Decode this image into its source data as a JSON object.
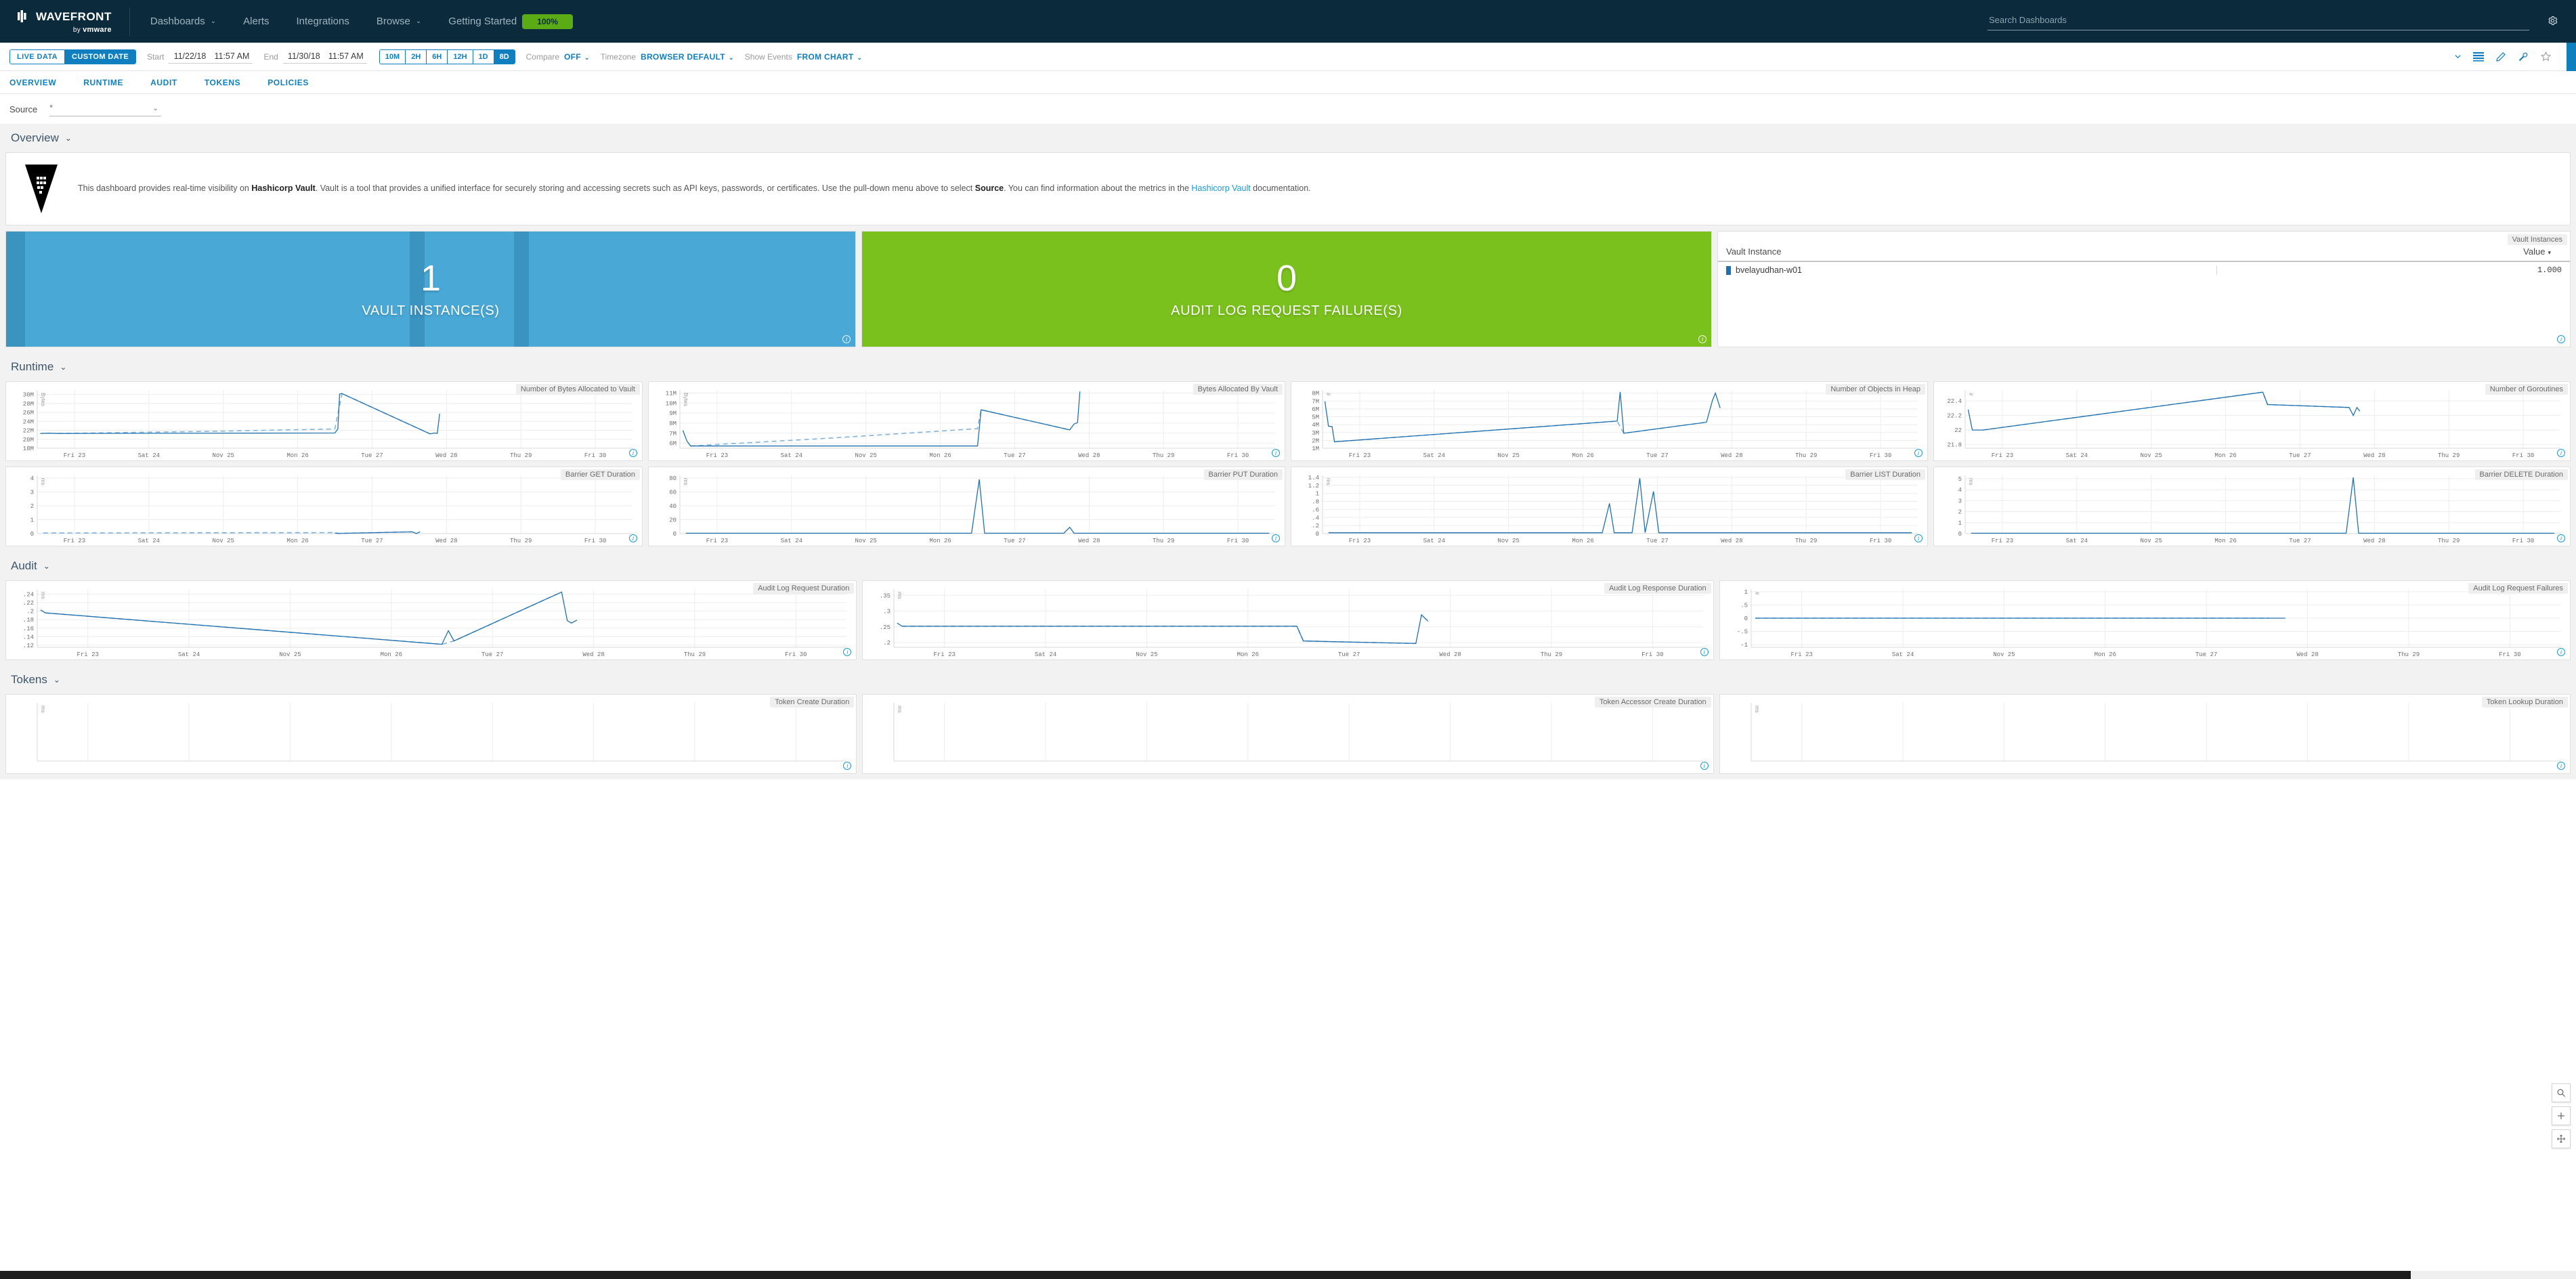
{
  "nav": {
    "brand_name": "WAVEFRONT",
    "brand_sub_prefix": "by ",
    "brand_sub_bold": "vmware",
    "items": [
      {
        "label": "Dashboards",
        "caret": "chevron-down"
      },
      {
        "label": "Alerts",
        "caret": null
      },
      {
        "label": "Integrations",
        "caret": null
      },
      {
        "label": "Browse",
        "caret": "chevron-down"
      },
      {
        "label": "Getting Started",
        "caret": null
      }
    ],
    "progress_pill": "100%",
    "search_placeholder": "Search Dashboards",
    "gear_icon": "gear-icon"
  },
  "toolbar": {
    "live_data": "LIVE DATA",
    "custom_date": "CUSTOM DATE",
    "start_label": "Start",
    "start_date": "11/22/18",
    "start_time": "11:57 AM",
    "end_label": "End",
    "end_date": "11/30/18",
    "end_time": "11:57 AM",
    "ranges": [
      "10M",
      "2H",
      "6H",
      "12H",
      "1D",
      "8D"
    ],
    "active_range": "8D",
    "compare_label": "Compare",
    "compare_value": "OFF",
    "timezone_label": "Timezone",
    "timezone_value": "BROWSER DEFAULT",
    "events_label": "Show Events",
    "events_value": "FROM CHART",
    "icons": [
      "chevron-down-icon",
      "list-icon",
      "pencil-icon",
      "wrench-icon",
      "star-icon"
    ]
  },
  "tabs": {
    "items": [
      "OVERVIEW",
      "RUNTIME",
      "AUDIT",
      "TOKENS",
      "POLICIES"
    ],
    "active": "OVERVIEW"
  },
  "source": {
    "label": "Source",
    "value": "*",
    "caret": "chevron-down-icon"
  },
  "sections": {
    "overview": {
      "title": "Overview",
      "description_parts": [
        "This dashboard provides real-time visibility on ",
        "Hashicorp Vault",
        ". Vault is a tool that provides a unified interface for securely storing and accessing secrets such as API keys, passwords, or certificates. Use the pull-down menu above to select ",
        "Source",
        ". You can find information about the metrics in the ",
        "Hashicorp Vault",
        " documentation."
      ],
      "tiles": [
        {
          "value": "1",
          "caption": "VAULT INSTANCE(S)",
          "color": "#49a8d6"
        },
        {
          "value": "0",
          "caption": "AUDIT LOG REQUEST FAILURE(S)",
          "color": "#7ac11e"
        }
      ],
      "table": {
        "chip": "Vault Instances",
        "columns": [
          "Vault Instance",
          "Value"
        ],
        "sort_caret": "▾",
        "rows": [
          {
            "name": "bvelayudhan-w01",
            "value": "1.000",
            "swatch": "#1f6fb2"
          }
        ]
      }
    },
    "runtime": {
      "title": "Runtime"
    },
    "audit": {
      "title": "Audit"
    },
    "tokens": {
      "title": "Tokens"
    }
  },
  "float_buttons": [
    {
      "icon": "search-icon",
      "glyph": "⚲"
    },
    {
      "icon": "plus-icon",
      "glyph": "+"
    },
    {
      "icon": "move-icon",
      "glyph": "✥"
    }
  ],
  "chart_data": [
    {
      "id": "bytes-allocated-to-vault",
      "type": "line",
      "title": "Number of Bytes Allocated to Vault",
      "ylabel": "Bytes",
      "yticks": [
        "30M",
        "28M",
        "26M",
        "24M",
        "22M",
        "20M",
        "18M"
      ],
      "ylim": [
        18000000,
        31000000
      ],
      "xticks": [
        "Fri 23",
        "Sat 24",
        "Nov 25",
        "Mon 26",
        "Tue 27",
        "Wed 28",
        "Thu 29",
        "Fri 30"
      ],
      "grid": true,
      "solid": [
        [
          0.005,
          21.3
        ],
        [
          0.02,
          21.35
        ],
        [
          0.035,
          21.3
        ],
        [
          0.5,
          21.4
        ],
        [
          0.505,
          22.3
        ],
        [
          0.508,
          30.1
        ],
        [
          0.512,
          30.2
        ],
        [
          0.66,
          21.2
        ],
        [
          0.668,
          21.4
        ],
        [
          0.672,
          21.3
        ],
        [
          0.676,
          25.7
        ]
      ],
      "dash": [
        [
          0.035,
          21.3
        ],
        [
          0.3,
          21.8
        ],
        [
          0.5,
          22.3
        ],
        [
          0.512,
          30.2
        ],
        [
          0.66,
          21.2
        ]
      ],
      "units": "M"
    },
    {
      "id": "bytes-allocated-by-vault",
      "type": "line",
      "title": "Bytes Allocated By Vault",
      "ylabel": "Bytes",
      "yticks": [
        "11M",
        "10M",
        "9M",
        "8M",
        "7M",
        "6M"
      ],
      "ylim": [
        5500000,
        11300000
      ],
      "xticks": [
        "Fri 23",
        "Sat 24",
        "Nov 25",
        "Mon 26",
        "Tue 27",
        "Wed 28",
        "Thu 29",
        "Fri 30"
      ],
      "grid": true,
      "solid": [
        [
          0.005,
          7.28
        ],
        [
          0.012,
          6.2
        ],
        [
          0.018,
          5.72
        ],
        [
          0.5,
          5.72
        ],
        [
          0.503,
          7.45
        ],
        [
          0.506,
          9.33
        ],
        [
          0.655,
          7.33
        ],
        [
          0.662,
          7.9
        ],
        [
          0.668,
          8.05
        ],
        [
          0.672,
          11.15
        ]
      ],
      "dash": [
        [
          0.018,
          5.72
        ],
        [
          0.25,
          6.5
        ],
        [
          0.5,
          7.45
        ],
        [
          0.506,
          9.33
        ],
        [
          0.655,
          7.33
        ]
      ],
      "units": "M"
    },
    {
      "id": "objects-in-heap",
      "type": "line",
      "title": "Number of Objects in Heap",
      "ylabel": "#",
      "yticks": [
        "8M",
        "7M",
        "6M",
        "5M",
        "4M",
        "3M",
        "2M",
        "1M"
      ],
      "ylim": [
        1000000,
        8400000
      ],
      "xticks": [
        "Fri 23",
        "Sat 24",
        "Nov 25",
        "Mon 26",
        "Tue 27",
        "Wed 28",
        "Thu 29",
        "Fri 30"
      ],
      "grid": true,
      "solid": [
        [
          0.004,
          6.95
        ],
        [
          0.01,
          3.8
        ],
        [
          0.016,
          3.75
        ],
        [
          0.02,
          1.82
        ],
        [
          0.495,
          4.45
        ],
        [
          0.5,
          8.15
        ],
        [
          0.506,
          2.9
        ],
        [
          0.645,
          4.3
        ],
        [
          0.655,
          7.05
        ],
        [
          0.66,
          8.0
        ],
        [
          0.668,
          6.1
        ]
      ],
      "dash": [
        [
          0.02,
          1.82
        ],
        [
          0.25,
          3.1
        ],
        [
          0.495,
          4.45
        ],
        [
          0.506,
          2.9
        ],
        [
          0.645,
          4.3
        ]
      ],
      "units": "M"
    },
    {
      "id": "goroutines",
      "type": "line",
      "title": "Number of Goroutines",
      "ylabel": "#",
      "yticks": [
        "22.4",
        "22.2",
        "22",
        "21.8"
      ],
      "ylim": [
        21.75,
        22.55
      ],
      "xticks": [
        "Fri 23",
        "Sat 24",
        "Nov 25",
        "Mon 26",
        "Tue 27",
        "Wed 28",
        "Thu 29",
        "Fri 30"
      ],
      "grid": true,
      "solid": [
        [
          0.005,
          22.28
        ],
        [
          0.012,
          22.0
        ],
        [
          0.03,
          22.0
        ],
        [
          0.5,
          22.52
        ],
        [
          0.508,
          22.35
        ],
        [
          0.645,
          22.31
        ],
        [
          0.652,
          22.2
        ],
        [
          0.658,
          22.31
        ],
        [
          0.663,
          22.26
        ]
      ],
      "dash": [
        [
          0.03,
          22.0
        ],
        [
          0.5,
          22.52
        ],
        [
          0.508,
          22.35
        ],
        [
          0.645,
          22.31
        ]
      ],
      "units": ""
    },
    {
      "id": "barrier-get-duration",
      "type": "line",
      "title": "Barrier GET Duration",
      "ylabel": "ms",
      "yticks": [
        "4",
        "3",
        "2",
        "1",
        "0"
      ],
      "ylim": [
        0,
        4.2
      ],
      "xticks": [
        "Fri 23",
        "Sat 24",
        "Nov 25",
        "Mon 26",
        "Tue 27",
        "Wed 28",
        "Thu 29",
        "Fri 30"
      ],
      "grid": true,
      "solid": [
        [
          0.5,
          0.03
        ],
        [
          0.505,
          0.01
        ],
        [
          0.63,
          0.12
        ],
        [
          0.637,
          0.0
        ],
        [
          0.643,
          0.12
        ]
      ],
      "dash": [
        [
          0.01,
          0.04
        ],
        [
          0.3,
          0.06
        ],
        [
          0.5,
          0.07
        ],
        [
          0.505,
          0.01
        ],
        [
          0.63,
          0.12
        ]
      ],
      "units": "ms"
    },
    {
      "id": "barrier-put-duration",
      "type": "line",
      "title": "Barrier PUT Duration",
      "ylabel": "ms",
      "yticks": [
        "80",
        "60",
        "40",
        "20",
        "0"
      ],
      "ylim": [
        0,
        84
      ],
      "xticks": [
        "Fri 23",
        "Sat 24",
        "Nov 25",
        "Mon 26",
        "Tue 27",
        "Wed 28",
        "Thu 29",
        "Fri 30"
      ],
      "grid": true,
      "solid": [
        [
          0.01,
          0.5
        ],
        [
          0.49,
          0.5
        ],
        [
          0.503,
          78
        ],
        [
          0.512,
          0.5
        ],
        [
          0.645,
          0.5
        ],
        [
          0.655,
          9
        ],
        [
          0.662,
          0.5
        ],
        [
          0.99,
          0.5
        ]
      ],
      "dash": [],
      "units": "ms"
    },
    {
      "id": "barrier-list-duration",
      "type": "line",
      "title": "Barrier LIST Duration",
      "ylabel": "ms",
      "yticks": [
        "1.4",
        "1.2",
        "1",
        ".8",
        ".6",
        ".4",
        ".2",
        "0"
      ],
      "ylim": [
        0,
        1.45
      ],
      "xticks": [
        "Fri 23",
        "Sat 24",
        "Nov 25",
        "Mon 26",
        "Tue 27",
        "Wed 28",
        "Thu 29",
        "Fri 30"
      ],
      "grid": true,
      "solid": [
        [
          0.01,
          0.02
        ],
        [
          0.47,
          0.02
        ],
        [
          0.482,
          0.75
        ],
        [
          0.49,
          0.02
        ],
        [
          0.52,
          0.02
        ],
        [
          0.533,
          1.38
        ],
        [
          0.542,
          0.02
        ],
        [
          0.556,
          1.05
        ],
        [
          0.565,
          0.02
        ],
        [
          0.99,
          0.02
        ]
      ],
      "dash": [],
      "units": "ms"
    },
    {
      "id": "barrier-delete-duration",
      "type": "line",
      "title": "Barrier DELETE Duration",
      "ylabel": "ms",
      "yticks": [
        "5",
        "4",
        "3",
        "2",
        "1",
        "0"
      ],
      "ylim": [
        0,
        5.3
      ],
      "xticks": [
        "Fri 23",
        "Sat 24",
        "Nov 25",
        "Mon 26",
        "Tue 27",
        "Wed 28",
        "Thu 29",
        "Fri 30"
      ],
      "grid": true,
      "solid": [
        [
          0.01,
          0.03
        ],
        [
          0.64,
          0.03
        ],
        [
          0.652,
          5.1
        ],
        [
          0.661,
          0.03
        ],
        [
          0.99,
          0.03
        ]
      ],
      "dash": [],
      "units": "ms"
    },
    {
      "id": "audit-log-request-duration",
      "type": "line",
      "title": "Audit Log Request Duration",
      "ylabel": "ms",
      "yticks": [
        ".24",
        ".22",
        ".2",
        ".18",
        ".16",
        ".14",
        ".12"
      ],
      "ylim": [
        0.115,
        0.252
      ],
      "xticks": [
        "Fri 23",
        "Sat 24",
        "Nov 25",
        "Mon 26",
        "Tue 27",
        "Wed 28",
        "Thu 29",
        "Fri 30"
      ],
      "grid": true,
      "solid": [
        [
          0.004,
          0.203
        ],
        [
          0.01,
          0.196
        ],
        [
          0.5,
          0.122
        ],
        [
          0.508,
          0.154
        ],
        [
          0.515,
          0.13
        ],
        [
          0.648,
          0.245
        ],
        [
          0.655,
          0.178
        ],
        [
          0.66,
          0.172
        ],
        [
          0.667,
          0.179
        ]
      ],
      "dash": [
        [
          0.01,
          0.196
        ],
        [
          0.5,
          0.122
        ],
        [
          0.515,
          0.13
        ],
        [
          0.648,
          0.245
        ]
      ],
      "units": "ms"
    },
    {
      "id": "audit-log-response-duration",
      "type": "line",
      "title": "Audit Log Response Duration",
      "ylabel": "ms",
      "yticks": [
        ".35",
        ".3",
        ".25",
        ".2"
      ],
      "ylim": [
        0.185,
        0.37
      ],
      "xticks": [
        "Fri 23",
        "Sat 24",
        "Nov 25",
        "Mon 26",
        "Tue 27",
        "Wed 28",
        "Thu 29",
        "Fri 30"
      ],
      "grid": true,
      "solid": [
        [
          0.004,
          0.262
        ],
        [
          0.01,
          0.252
        ],
        [
          0.498,
          0.252
        ],
        [
          0.506,
          0.205
        ],
        [
          0.645,
          0.197
        ],
        [
          0.652,
          0.288
        ],
        [
          0.66,
          0.268
        ]
      ],
      "dash": [
        [
          0.01,
          0.252
        ],
        [
          0.3,
          0.252
        ],
        [
          0.498,
          0.252
        ],
        [
          0.506,
          0.205
        ],
        [
          0.645,
          0.197
        ]
      ],
      "units": "ms"
    },
    {
      "id": "audit-log-request-failures",
      "type": "line",
      "title": "Audit Log Request Failures",
      "ylabel": "#",
      "yticks": [
        "1",
        ".5",
        "0",
        "-.5",
        "-1"
      ],
      "ylim": [
        -1.1,
        1.1
      ],
      "xticks": [
        "Fri 23",
        "Sat 24",
        "Nov 25",
        "Mon 26",
        "Tue 27",
        "Wed 28",
        "Thu 29",
        "Fri 30"
      ],
      "grid": true,
      "solid": [
        [
          0.005,
          0
        ],
        [
          0.44,
          0
        ],
        [
          0.47,
          0
        ],
        [
          0.64,
          0
        ],
        [
          0.66,
          0
        ]
      ],
      "dash": [
        [
          0.005,
          0
        ],
        [
          0.44,
          0
        ],
        [
          0.47,
          0
        ],
        [
          0.64,
          0
        ]
      ],
      "units": ""
    },
    {
      "id": "token-create-duration",
      "type": "line",
      "title": "Token Create Duration",
      "ylabel": "ms",
      "yticks": [],
      "ylim": [
        0,
        1
      ],
      "xticks": [],
      "grid": true,
      "solid": [],
      "dash": [],
      "units": "ms"
    },
    {
      "id": "token-accessor-create-duration",
      "type": "line",
      "title": "Token Accessor Create Duration",
      "ylabel": "ms",
      "yticks": [],
      "ylim": [
        0,
        1
      ],
      "xticks": [],
      "grid": true,
      "solid": [],
      "dash": [],
      "units": "ms"
    },
    {
      "id": "token-lookup-duration",
      "type": "line",
      "title": "Token Lookup Duration",
      "ylabel": "ms",
      "yticks": [],
      "ylim": [
        0,
        1
      ],
      "xticks": [],
      "grid": true,
      "solid": [],
      "dash": [],
      "units": "ms"
    }
  ]
}
